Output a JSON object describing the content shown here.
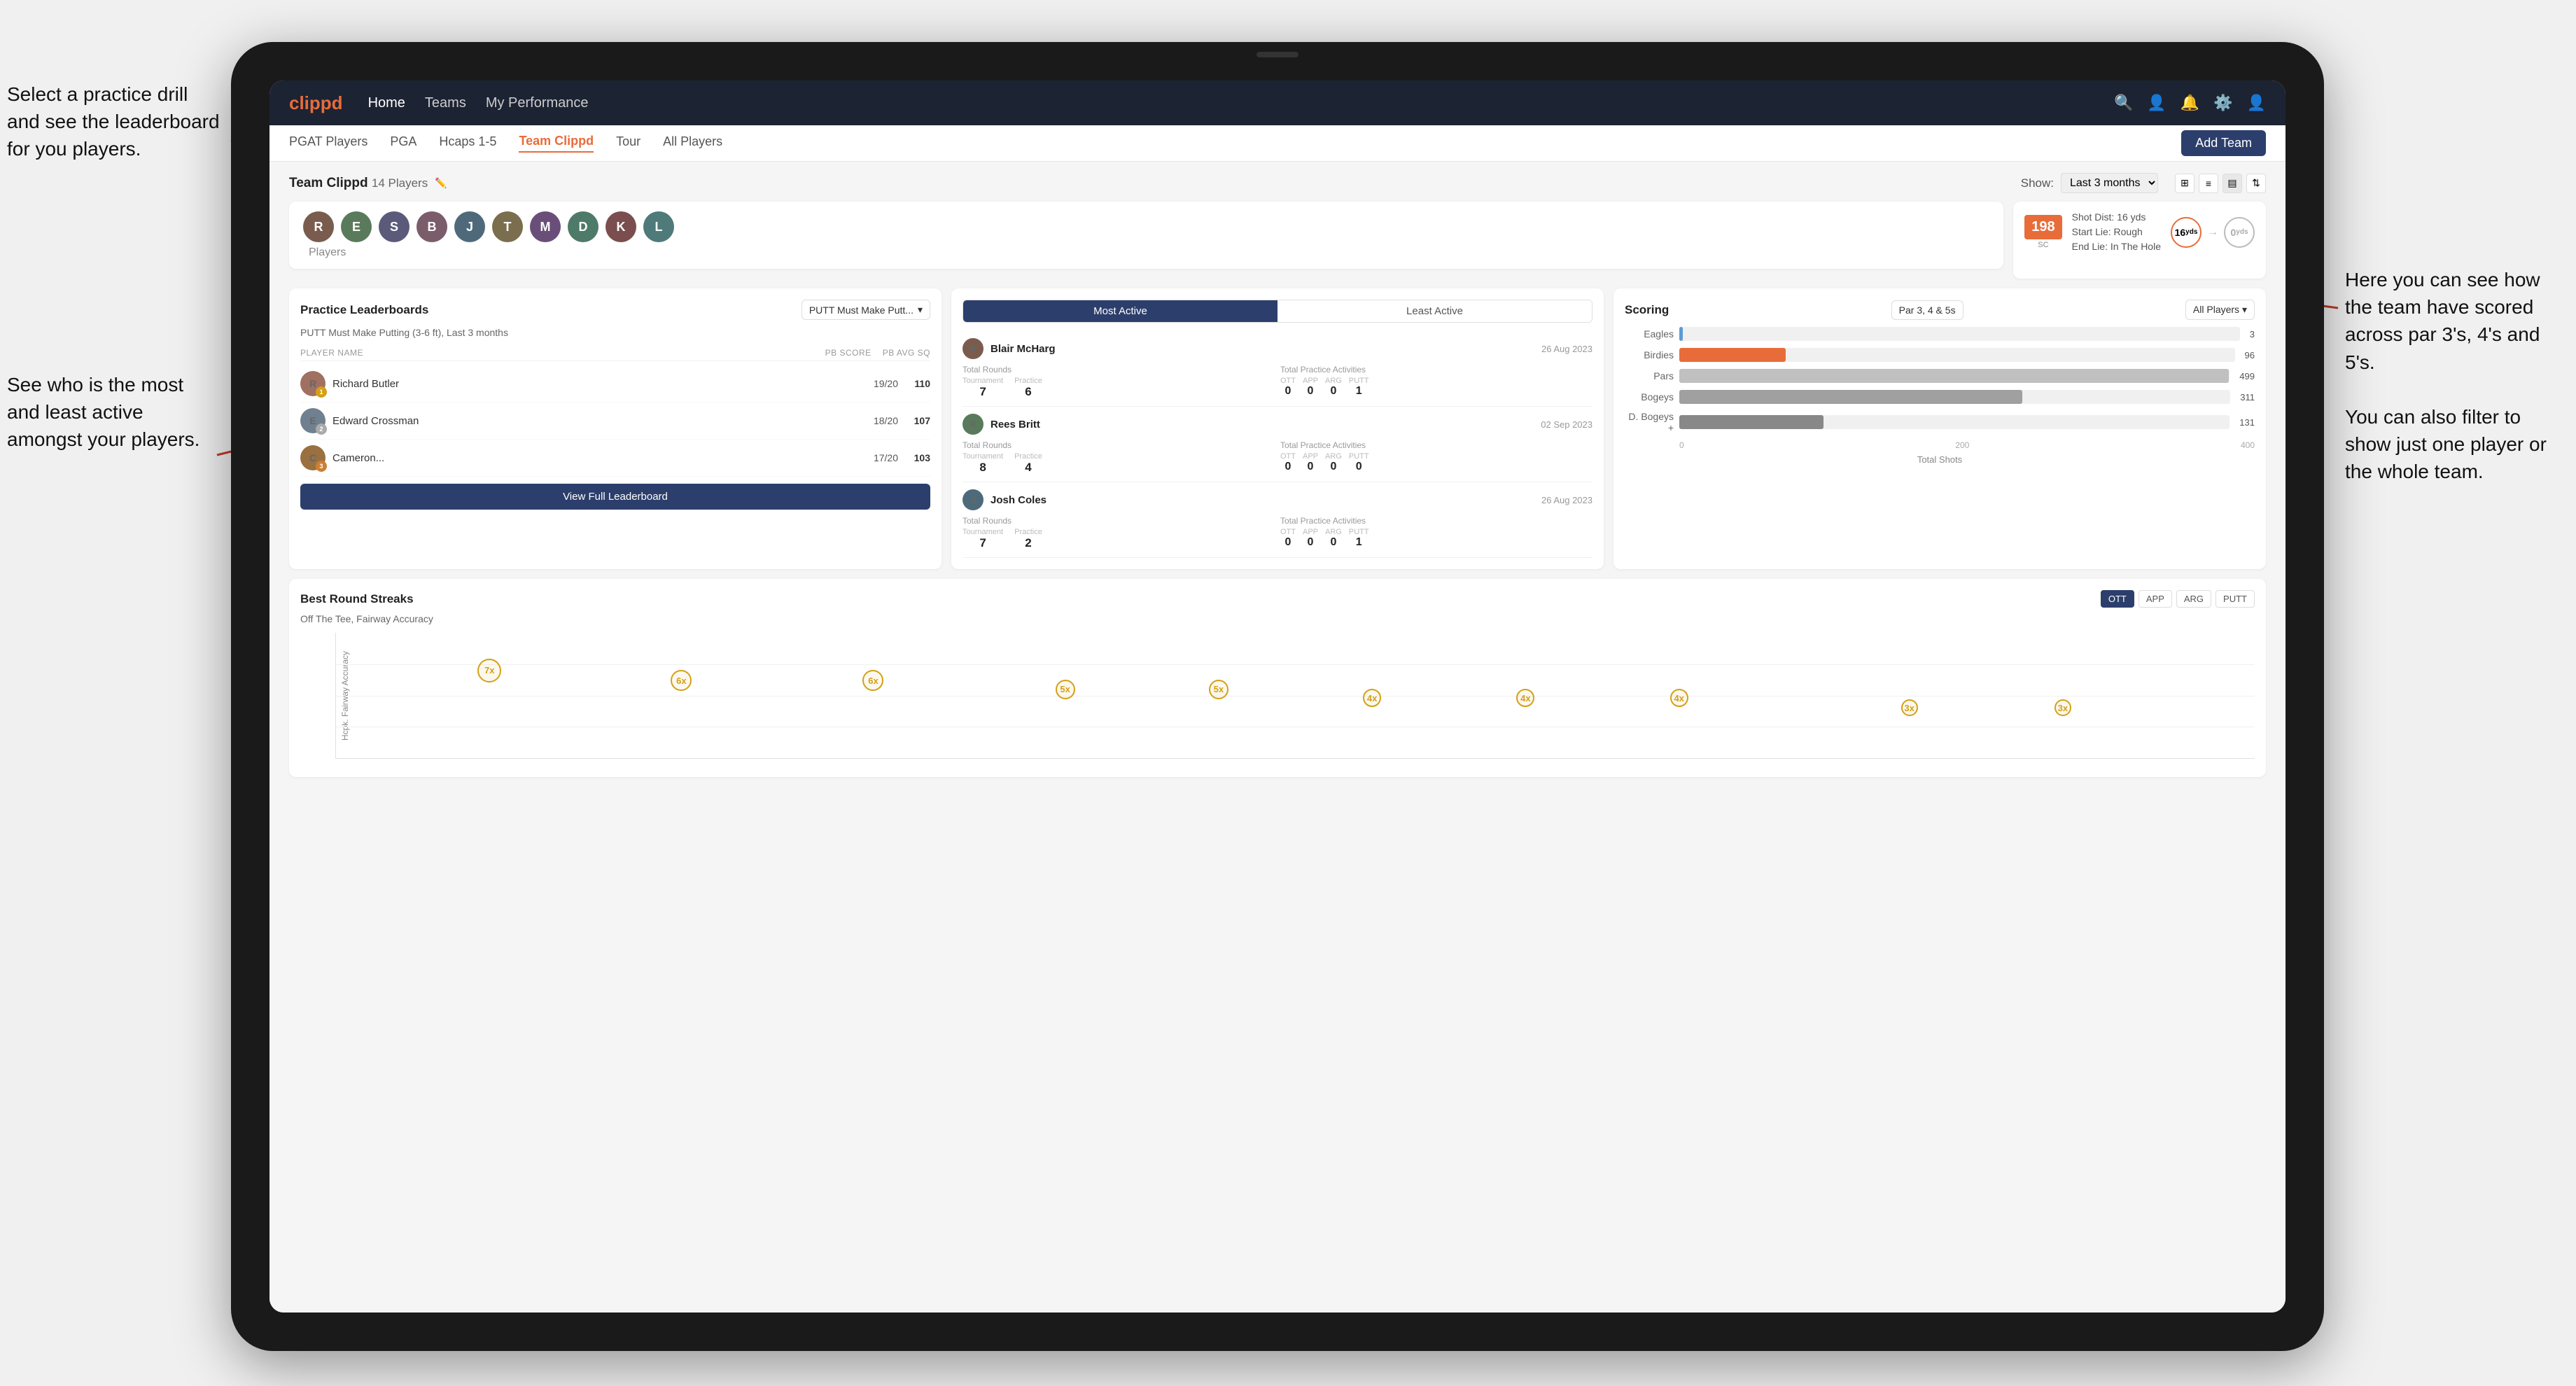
{
  "annotations": {
    "top_left": "Select a practice drill and see the leaderboard for you players.",
    "bottom_left": "See who is the most and least active amongst your players.",
    "right": "Here you can see how the team have scored across par 3's, 4's and 5's.\n\nYou can also filter to show just one player or the whole team."
  },
  "nav": {
    "logo": "clippd",
    "links": [
      "Home",
      "Teams",
      "My Performance"
    ],
    "icons": [
      "search",
      "person",
      "bell",
      "settings",
      "user"
    ]
  },
  "sub_nav": {
    "links": [
      "PGAT Players",
      "PGA",
      "Hcaps 1-5",
      "Team Clippd",
      "Tour",
      "All Players"
    ],
    "active": "Team Clippd",
    "add_team": "Add Team"
  },
  "team": {
    "name": "Team Clippd",
    "player_count": "14 Players",
    "show_label": "Show:",
    "show_value": "Last 3 months",
    "players": [
      {
        "initials": "R",
        "color": "#7a5c4e"
      },
      {
        "initials": "E",
        "color": "#5a7a5c"
      },
      {
        "initials": "S",
        "color": "#5c5a7a"
      },
      {
        "initials": "B",
        "color": "#7a5c6a"
      },
      {
        "initials": "J",
        "color": "#4e6a7a"
      },
      {
        "initials": "T",
        "color": "#7a6e4e"
      },
      {
        "initials": "M",
        "color": "#6a4e7a"
      },
      {
        "initials": "D",
        "color": "#4e7a6a"
      },
      {
        "initials": "K",
        "color": "#7a4e4e"
      },
      {
        "initials": "L",
        "color": "#4e7a7a"
      }
    ]
  },
  "shot_card": {
    "number": "198",
    "unit": "SC",
    "info_line1": "Shot Dist: 16 yds",
    "info_line2": "Start Lie: Rough",
    "info_line3": "End Lie: In The Hole",
    "yards1": "16",
    "yards1_label": "yds",
    "yards2": "0",
    "yards2_label": "yds"
  },
  "practice_leaderboard": {
    "title": "Practice Leaderboards",
    "dropdown": "PUTT Must Make Putt...",
    "subtitle": "PUTT Must Make Putting (3-6 ft), Last 3 months",
    "col_player": "PLAYER NAME",
    "col_score": "PB SCORE",
    "col_avg": "PB AVG SQ",
    "players": [
      {
        "name": "Richard Butler",
        "score": "19/20",
        "avg": "110",
        "badge": "gold",
        "badge_num": "1"
      },
      {
        "name": "Edward Crossman",
        "score": "18/20",
        "avg": "107",
        "badge": "silver",
        "badge_num": "2"
      },
      {
        "name": "Cameron...",
        "score": "17/20",
        "avg": "103",
        "badge": "bronze",
        "badge_num": "3"
      }
    ],
    "view_full": "View Full Leaderboard"
  },
  "activity": {
    "tabs": [
      "Most Active",
      "Least Active"
    ],
    "active_tab": "Most Active",
    "players": [
      {
        "name": "Blair McHarg",
        "date": "26 Aug 2023",
        "total_rounds_label": "Total Rounds",
        "tournament": "7",
        "practice": "6",
        "practice_activities_label": "Total Practice Activities",
        "ott": "0",
        "app": "0",
        "arg": "0",
        "putt": "1"
      },
      {
        "name": "Rees Britt",
        "date": "02 Sep 2023",
        "total_rounds_label": "Total Rounds",
        "tournament": "8",
        "practice": "4",
        "practice_activities_label": "Total Practice Activities",
        "ott": "0",
        "app": "0",
        "arg": "0",
        "putt": "0"
      },
      {
        "name": "Josh Coles",
        "date": "26 Aug 2023",
        "total_rounds_label": "Total Rounds",
        "tournament": "7",
        "practice": "2",
        "practice_activities_label": "Total Practice Activities",
        "ott": "0",
        "app": "0",
        "arg": "0",
        "putt": "1"
      }
    ]
  },
  "scoring": {
    "title": "Scoring",
    "filter1": "Par 3, 4 & 5s",
    "filter2": "All Players",
    "bars": [
      {
        "label": "Eagles",
        "value": 3,
        "max": 500,
        "color": "#5b9bd5"
      },
      {
        "label": "Birdies",
        "value": 96,
        "max": 500,
        "color": "#e86c3a"
      },
      {
        "label": "Pars",
        "value": 499,
        "max": 500,
        "color": "#c0c0c0"
      },
      {
        "label": "Bogeys",
        "value": 311,
        "max": 500,
        "color": "#a0a0a0"
      },
      {
        "label": "D. Bogeys +",
        "value": 131,
        "max": 500,
        "color": "#888"
      }
    ],
    "x_labels": [
      "0",
      "200",
      "400"
    ],
    "x_title": "Total Shots"
  },
  "streaks": {
    "title": "Best Round Streaks",
    "filter_btns": [
      "OTT",
      "APP",
      "ARG",
      "PUTT"
    ],
    "active_filter": "OTT",
    "subtitle": "Off The Tee, Fairway Accuracy",
    "y_label": "Hcpk. Fairway Accuracy",
    "bubbles": [
      {
        "x": 8,
        "y": 60,
        "label": "7x"
      },
      {
        "x": 18,
        "y": 55,
        "label": "6x"
      },
      {
        "x": 28,
        "y": 55,
        "label": "6x"
      },
      {
        "x": 38,
        "y": 50,
        "label": "5x"
      },
      {
        "x": 48,
        "y": 50,
        "label": "5x"
      },
      {
        "x": 58,
        "y": 45,
        "label": "4x"
      },
      {
        "x": 68,
        "y": 45,
        "label": "4x"
      },
      {
        "x": 78,
        "y": 45,
        "label": "4x"
      },
      {
        "x": 88,
        "y": 40,
        "label": "3x"
      },
      {
        "x": 95,
        "y": 40,
        "label": "3x"
      }
    ]
  }
}
